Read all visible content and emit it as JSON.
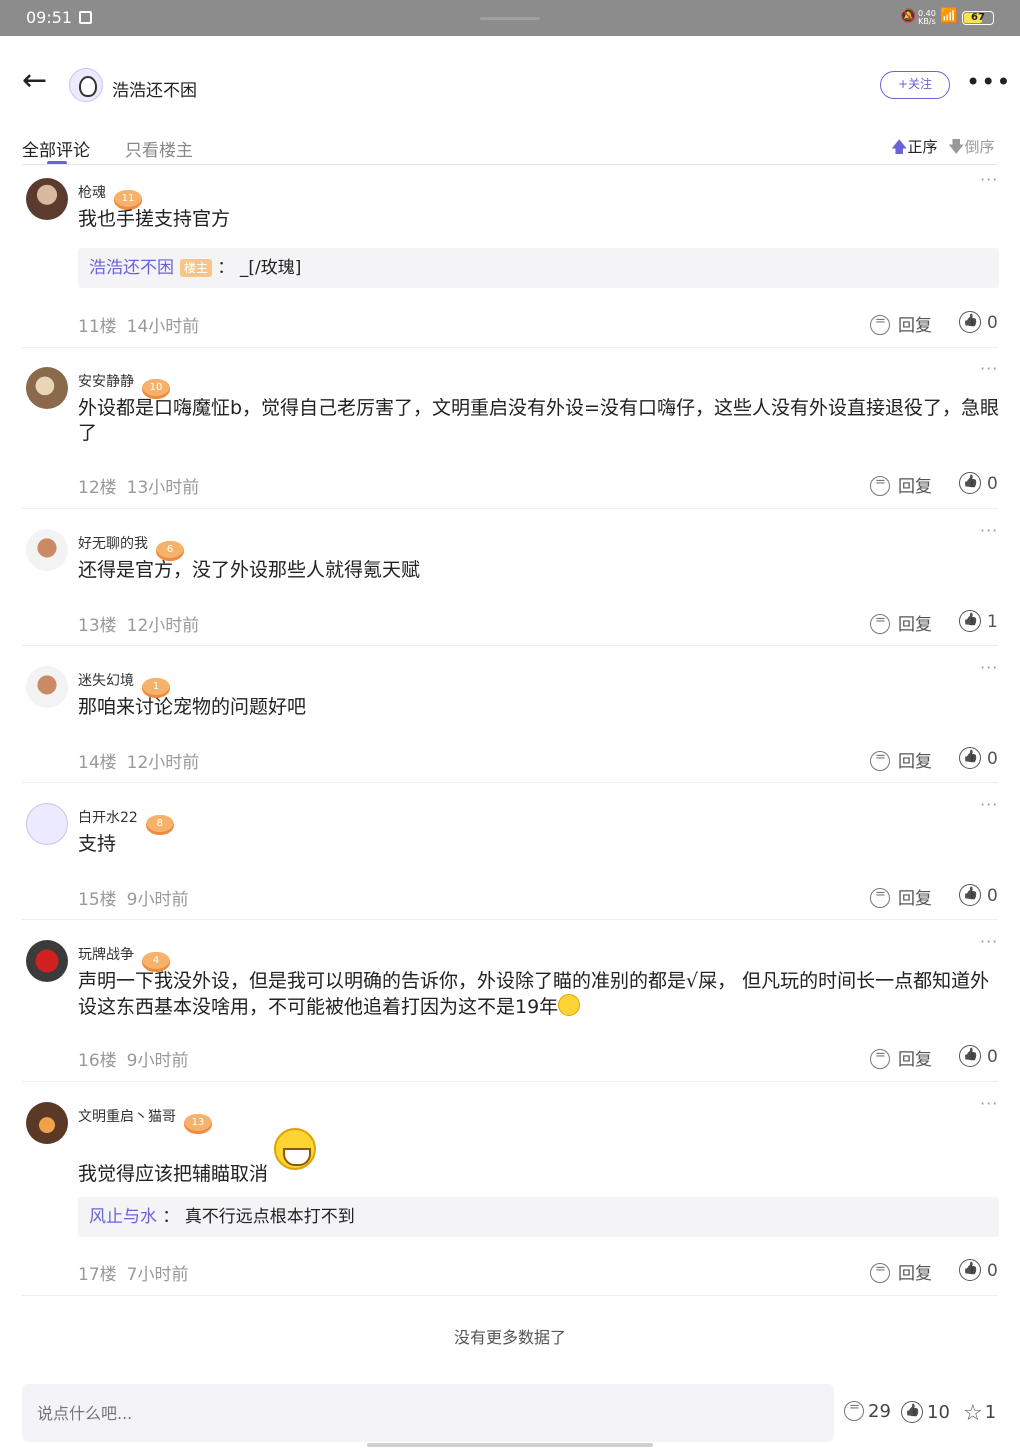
{
  "status_bar": {
    "time": "09:51",
    "speed_value": "0.40",
    "speed_unit": "KB/s",
    "battery": "67"
  },
  "header": {
    "user_name": "浩浩还不困",
    "follow_label": "+关注",
    "more_label": "•••"
  },
  "tabs": {
    "all_comments": "全部评论",
    "owner_only": "只看楼主",
    "sort_asc": "正序",
    "sort_desc": "倒序"
  },
  "comments": [
    {
      "name": "枪魂",
      "level": "11",
      "text": "我也手搓支持官方",
      "quote": {
        "name": "浩浩还不困",
        "tag": "楼主",
        "sep": "：",
        "text": "_[/玫瑰]"
      },
      "floor": "11楼",
      "time": "14小时前",
      "reply": "回复",
      "likes": "0"
    },
    {
      "name": "安安静静",
      "level": "10",
      "text": "外设都是口嗨魔怔b，觉得自己老厉害了，文明重启没有外设=没有口嗨仔，这些人没有外设直接退役了，急眼了",
      "floor": "12楼",
      "time": "13小时前",
      "reply": "回复",
      "likes": "0"
    },
    {
      "name": "好无聊的我",
      "level": "6",
      "text": "还得是官方，没了外设那些人就得氪天赋",
      "floor": "13楼",
      "time": "12小时前",
      "reply": "回复",
      "likes": "1"
    },
    {
      "name": "迷失幻境",
      "level": "1",
      "text": "那咱来讨论宠物的问题好吧",
      "floor": "14楼",
      "time": "12小时前",
      "reply": "回复",
      "likes": "0"
    },
    {
      "name": "白开水22",
      "level": "8",
      "text": "支持",
      "floor": "15楼",
      "time": "9小时前",
      "reply": "回复",
      "likes": "0"
    },
    {
      "name": "玩牌战争",
      "level": "4",
      "text": "声明一下我没外设，但是我可以明确的告诉你，外设除了瞄的准别的都是√屎， 但凡玩的时间长一点都知道外设这东西基本没啥用，不可能被他追着打因为这不是19年",
      "floor": "16楼",
      "time": "9小时前",
      "reply": "回复",
      "likes": "0"
    },
    {
      "name": "文明重启丶猫哥",
      "level": "13",
      "text": "我觉得应该把辅瞄取消",
      "quote": {
        "name": "风止与水",
        "sep": "：",
        "text": "真不行远点根本打不到"
      },
      "floor": "17楼",
      "time": "7小时前",
      "reply": "回复",
      "likes": "0"
    }
  ],
  "icons": [
    "back-arrow-icon",
    "more-icon",
    "sort-up-icon",
    "sort-down-icon",
    "reply-icon",
    "like-icon",
    "star-icon"
  ],
  "footer": {
    "no_more": "没有更多数据了",
    "input_placeholder": "说点什么吧...",
    "comment_count": "29",
    "like_count": "10",
    "fav_count": "1"
  },
  "colors": {
    "accent": "#6a63d8",
    "badge": "#f6b26b",
    "quote_bg": "#f4f4f6"
  }
}
